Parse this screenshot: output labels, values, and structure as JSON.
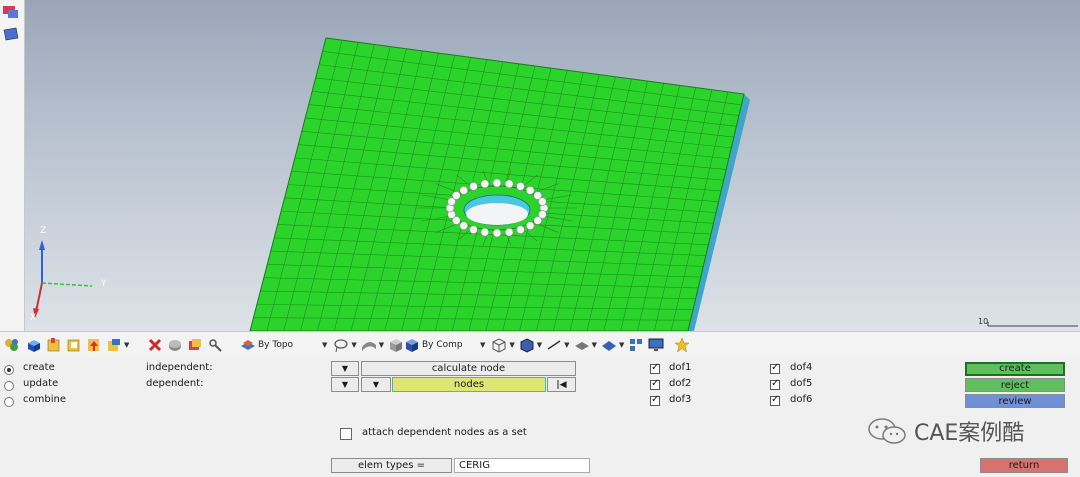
{
  "toolbar": {
    "topo_label": "By Topo",
    "comp_label": "By Comp"
  },
  "viewport": {
    "axis_x": "X",
    "axis_y": "Y",
    "axis_z": "Z",
    "scale_label": "10"
  },
  "panel": {
    "mode_create": "create",
    "mode_update": "update",
    "mode_combine": "combine",
    "independent_label": "independent:",
    "dependent_label": "dependent:",
    "calculate_node": "calculate node",
    "nodes": "nodes",
    "dof1": "dof1",
    "dof2": "dof2",
    "dof3": "dof3",
    "dof4": "dof4",
    "dof5": "dof5",
    "dof6": "dof6",
    "attach_set": "attach dependent nodes as a set",
    "elem_types": "elem types =",
    "elem_value": "CERIG",
    "create": "create",
    "reject": "reject",
    "review": "review",
    "return": "return"
  },
  "watermark": "CAE案例酷",
  "colors": {
    "mesh": "#2ad42a",
    "hole": "#4ac8e0",
    "nodes_field": "#e2e472",
    "create_btn": "#5fbf5f",
    "review_btn": "#6f8fd8",
    "return_btn": "#d97171"
  }
}
